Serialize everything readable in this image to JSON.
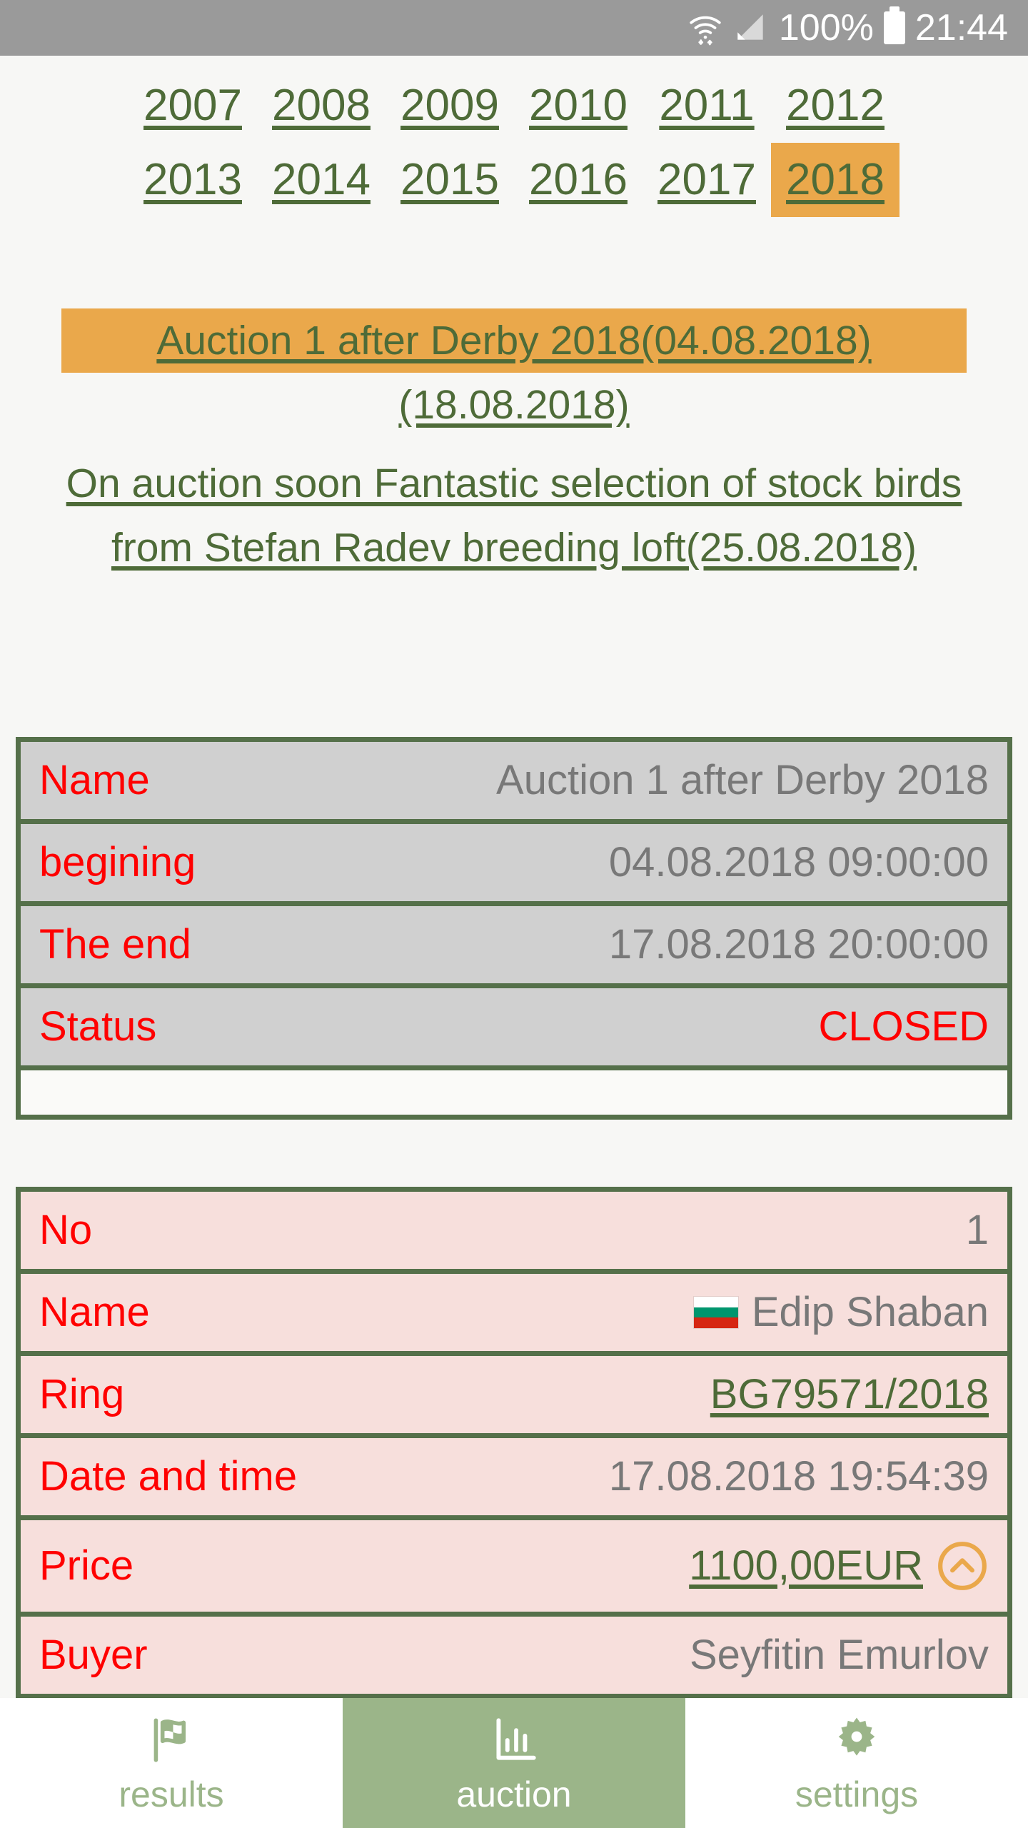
{
  "status_bar": {
    "wifi_icon": "wifi-icon",
    "signal_icon": "signal-icon",
    "battery_percent": "100%",
    "battery_icon": "battery-icon",
    "clock": "21:44"
  },
  "years": {
    "selected": "2018",
    "items": [
      "2007",
      "2008",
      "2009",
      "2010",
      "2011",
      "2012",
      "2013",
      "2014",
      "2015",
      "2016",
      "2017",
      "2018"
    ]
  },
  "auction_links": [
    {
      "label": "Auction 1 after Derby 2018(04.08.2018)",
      "highlighted": true
    },
    {
      "label": "(18.08.2018)",
      "highlighted": false
    },
    {
      "label": "On auction soon Fantastic selection of stock birds from Stefan Radev breeding loft(25.08.2018)",
      "highlighted": false
    }
  ],
  "info_table": {
    "rows": [
      {
        "label": "Name",
        "value": "Auction 1 after Derby 2018"
      },
      {
        "label": "begining",
        "value": "04.08.2018 09:00:00"
      },
      {
        "label": "The end",
        "value": "17.08.2018 20:00:00"
      },
      {
        "label": "Status",
        "value": "CLOSED"
      }
    ]
  },
  "bid_table": {
    "rows": [
      {
        "label": "No",
        "value": "1"
      },
      {
        "label": "Name",
        "value": "Edip Shaban"
      },
      {
        "label": "Ring",
        "value": "BG79571/2018"
      },
      {
        "label": "Date and time",
        "value": "17.08.2018 19:54:39"
      },
      {
        "label": "Price",
        "value": "1100,00EUR"
      },
      {
        "label": "Buyer",
        "value": "Seyfitin Emurlov"
      }
    ],
    "flag_icon": "bulgaria-flag-icon",
    "bump_icon": "chevron-up-circle-icon"
  },
  "bottom_nav": {
    "items": [
      {
        "label": "results",
        "icon": "checkered-flag-icon",
        "active": false
      },
      {
        "label": "auction",
        "icon": "bar-chart-icon",
        "active": true
      },
      {
        "label": "settings",
        "icon": "gear-icon",
        "active": false
      }
    ]
  },
  "colors": {
    "green": "#4E6B38",
    "border_green": "#55704A",
    "orange": "#EAA84B",
    "red": "#FF0000",
    "gray_value": "#787878",
    "row_gray": "#D0D0D0",
    "row_pink": "#F7DFDC",
    "nav_green": "#9BB589",
    "page_bg": "#F7F7F5"
  }
}
